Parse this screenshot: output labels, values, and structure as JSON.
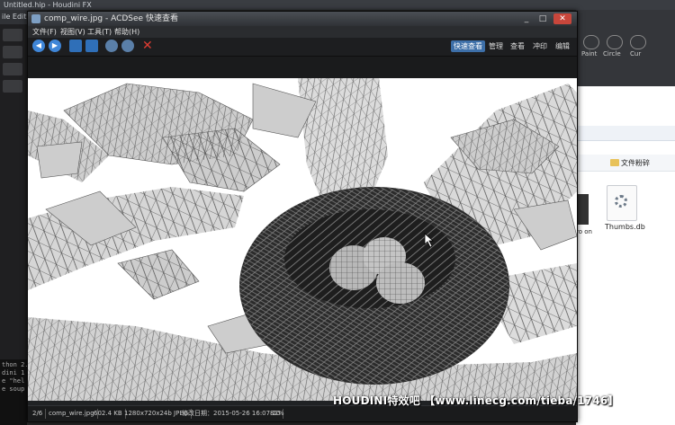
{
  "background_app": {
    "title": "Untitled.hip - Houdini FX",
    "menu": [
      "ile",
      "Edit"
    ],
    "console_lines": [
      "thon 2.",
      "dini 1",
      "e \"hel",
      "e soup"
    ],
    "shelf_labels": [
      "Paint",
      "Circle",
      "Cur"
    ],
    "explorer_toolbar_label": "文件粉碎",
    "explorer_file_name": "Thumbs.db",
    "explorer_partial_label": "ro on"
  },
  "window": {
    "title": "comp_wire.jpg - ACDSee 快速查看",
    "controls": {
      "minimize": "_",
      "maximize": "□",
      "close": "✕"
    }
  },
  "menu": {
    "file": "文件(F)",
    "view": "视图(V)",
    "tools": "工具(T)",
    "help": "帮助(H)"
  },
  "toolbar": {
    "icons": [
      "back-icon",
      "forward-icon",
      "rotate-left-icon",
      "rotate-right-icon",
      "zoom-in-icon",
      "zoom-out-icon",
      "delete-icon"
    ],
    "modes": [
      "快速查看",
      "管理",
      "查看",
      "冲印",
      "编辑"
    ],
    "active_mode": "快速查看"
  },
  "image": {
    "subject": "wireframe render of a bird nest with three eggs in a tree"
  },
  "status": {
    "index": "2/6",
    "filename": "comp_wire.jpg",
    "size": "602.4 KB",
    "dimensions": "1280x720x24b JPEG",
    "modified": "修改日期：2015-05-26 16:07:20",
    "zoom": "82%"
  },
  "watermark": "HOUDINI特效吧 【www.linecg.com/tieba/1746】",
  "colors": {
    "accent": "#3d6fa8",
    "close": "#c8463b",
    "delete": "#e03c32",
    "nav_blue": "#3f86d8"
  }
}
